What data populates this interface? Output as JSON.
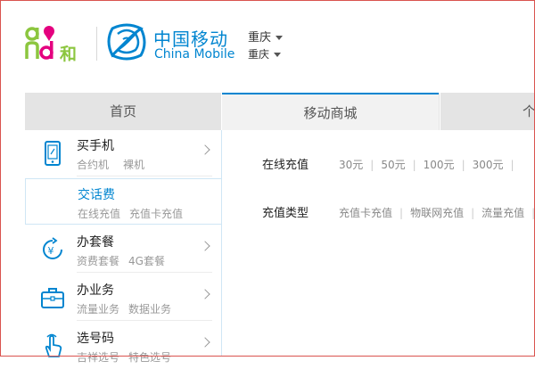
{
  "header": {
    "and_logo_text": "and和",
    "brand_cn": "中国移动",
    "brand_en": "China Mobile",
    "city_primary": "重庆",
    "city_secondary": "重庆"
  },
  "nav": {
    "tabs": [
      {
        "label": "首页"
      },
      {
        "label": "移动商城"
      },
      {
        "label": "个"
      }
    ],
    "active_color": "#0085d0"
  },
  "sidebar": {
    "items": [
      {
        "title": "买手机",
        "links": [
          "合约机",
          "裸机"
        ],
        "icon": "phone-icon"
      },
      {
        "title": "交话费",
        "links": [
          "在线充值",
          "充值卡充值"
        ],
        "icon": "",
        "active": true
      },
      {
        "title": "办套餐",
        "links": [
          "资费套餐",
          "4G套餐"
        ],
        "icon": "yuan-refresh-icon"
      },
      {
        "title": "办业务",
        "links": [
          "流量业务",
          "数据业务"
        ],
        "icon": "briefcase-icon"
      },
      {
        "title": "选号码",
        "links": [
          "吉祥选号",
          "特色选号"
        ],
        "icon": "hand-pointer-icon"
      }
    ]
  },
  "content": {
    "online_recharge": {
      "label": "在线充值",
      "options": [
        "30元",
        "50元",
        "100元",
        "300元"
      ]
    },
    "recharge_type": {
      "label": "充值类型",
      "options": [
        "充值卡充值",
        "物联网充值",
        "流量充值"
      ]
    }
  },
  "colors": {
    "brand_blue": "#0085d0",
    "and_green": "#8cc63f",
    "and_pink": "#e4007f"
  }
}
